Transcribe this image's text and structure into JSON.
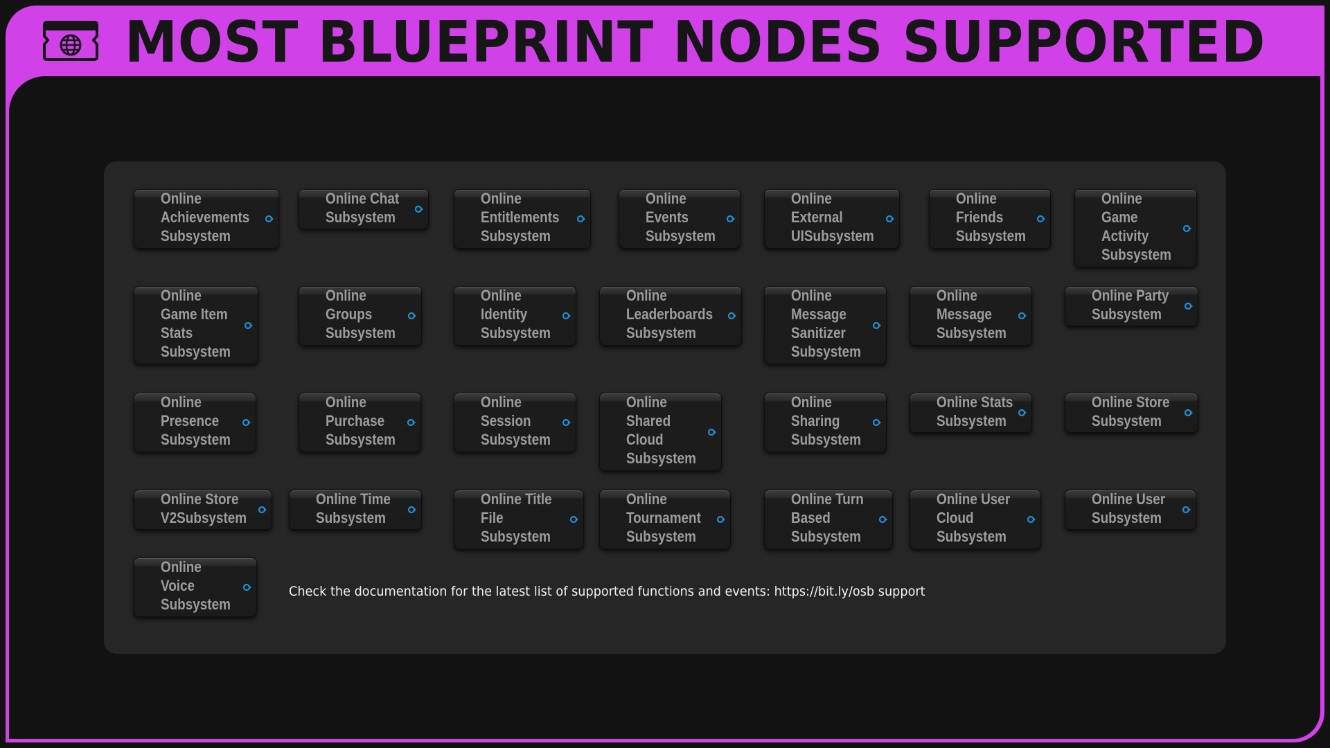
{
  "header": {
    "title": "MOST BLUEPRINT NODES SUPPORTED",
    "icon": "ticket-globe-icon",
    "accent_color": "#d042e8"
  },
  "nodes": [
    {
      "label": "Online\nAchievements\nSubsystem"
    },
    {
      "label": "Online Chat\nSubsystem"
    },
    {
      "label": "Online\nEntitlements\nSubsystem"
    },
    {
      "label": "Online\nEvents\nSubsystem"
    },
    {
      "label": "Online\nExternal\nUISubsystem"
    },
    {
      "label": "Online\nFriends\nSubsystem"
    },
    {
      "label": "Online\nGame\nActivity\nSubsystem"
    },
    {
      "label": "Online\nGame Item\nStats\nSubsystem"
    },
    {
      "label": "Online\nGroups\nSubsystem"
    },
    {
      "label": "Online\nIdentity\nSubsystem"
    },
    {
      "label": "Online\nLeaderboards\nSubsystem"
    },
    {
      "label": "Online\nMessage\nSanitizer\nSubsystem"
    },
    {
      "label": "Online\nMessage\nSubsystem"
    },
    {
      "label": "Online Party\nSubsystem"
    },
    {
      "label": "Online\nPresence\nSubsystem"
    },
    {
      "label": "Online\nPurchase\nSubsystem"
    },
    {
      "label": "Online\nSession\nSubsystem"
    },
    {
      "label": "Online\nShared\nCloud\nSubsystem"
    },
    {
      "label": "Online\nSharing\nSubsystem"
    },
    {
      "label": "Online Stats\nSubsystem"
    },
    {
      "label": "Online Store\nSubsystem"
    },
    {
      "label": "Online Store\nV2Subsystem"
    },
    {
      "label": "Online Time\nSubsystem"
    },
    {
      "label": "Online Title\nFile\nSubsystem"
    },
    {
      "label": "Online\nTournament\nSubsystem"
    },
    {
      "label": "Online Turn\nBased\nSubsystem"
    },
    {
      "label": "Online User\nCloud\nSubsystem"
    },
    {
      "label": "Online User\nSubsystem"
    },
    {
      "label": "Online\nVoice\nSubsystem"
    }
  ],
  "pin_color": "#1f8fd6",
  "note": {
    "text": "Check the documentation for the latest list of supported functions and events: https://bit.ly/osb support"
  }
}
